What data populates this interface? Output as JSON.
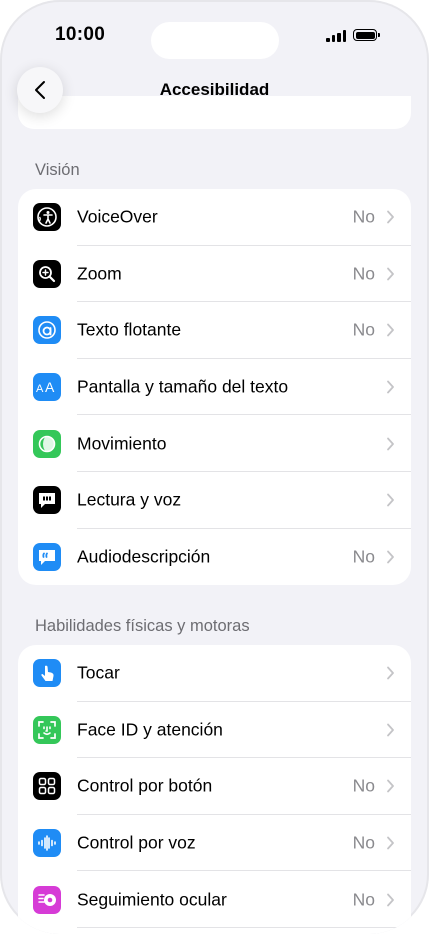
{
  "status_bar": {
    "time": "10:00"
  },
  "nav": {
    "title": "Accesibilidad",
    "back_icon": "chevron-left-icon"
  },
  "sections": {
    "vision": {
      "header": "Visión",
      "items": [
        {
          "label": "VoiceOver",
          "value": "No",
          "icon": "voiceover-icon",
          "color": "#000000"
        },
        {
          "label": "Zoom",
          "value": "No",
          "icon": "zoom-icon",
          "color": "#000000"
        },
        {
          "label": "Texto flotante",
          "value": "No",
          "icon": "hover-text-icon",
          "color": "#1f8cf5"
        },
        {
          "label": "Pantalla y tamaño del texto",
          "value": "",
          "icon": "text-size-icon",
          "color": "#1f8cf5"
        },
        {
          "label": "Movimiento",
          "value": "",
          "icon": "motion-icon",
          "color": "#34c759"
        },
        {
          "label": "Lectura y voz",
          "value": "",
          "icon": "spoken-content-icon",
          "color": "#000000"
        },
        {
          "label": "Audiodescripción",
          "value": "No",
          "icon": "audio-description-icon",
          "color": "#1f8cf5"
        }
      ]
    },
    "physical": {
      "header": "Habilidades físicas y motoras",
      "items": [
        {
          "label": "Tocar",
          "value": "",
          "icon": "touch-icon",
          "color": "#1f8cf5"
        },
        {
          "label": "Face ID y atención",
          "value": "",
          "icon": "face-id-icon",
          "color": "#34c759"
        },
        {
          "label": "Control por botón",
          "value": "No",
          "icon": "switch-control-icon",
          "color": "#000000"
        },
        {
          "label": "Control por voz",
          "value": "No",
          "icon": "voice-control-icon",
          "color": "#1f8cf5"
        },
        {
          "label": "Seguimiento ocular",
          "value": "No",
          "icon": "eye-tracking-icon",
          "color": "#d63bd6"
        }
      ]
    }
  }
}
